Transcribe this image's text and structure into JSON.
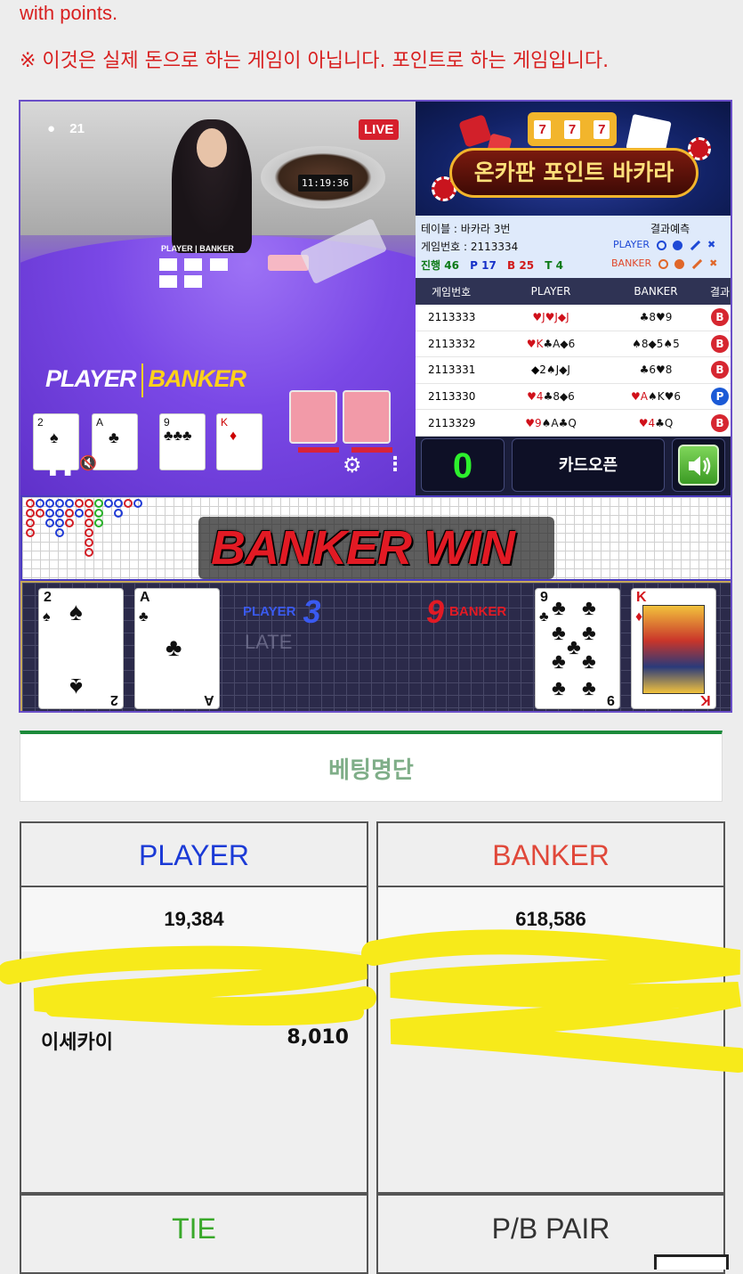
{
  "notice": {
    "line1": "with points.",
    "line2": "※ 이것은 실제 돈으로 하는 게임이 아닙니다. 포인트로 하는 게임입니다."
  },
  "video": {
    "viewers": "21",
    "live_label": "LIVE",
    "clock": "11:19:36",
    "table_label": "PLAYER | BANKER",
    "player_label": "PLAYER",
    "banker_label": "BANKER"
  },
  "logo": {
    "slot": [
      "7",
      "7",
      "7"
    ],
    "title": "온카판 포인트 바카라"
  },
  "info": {
    "table": "테이블 : 바카라 3번",
    "game_no": "게임번호 : 2113334",
    "progress_label": "진행 46",
    "p_count": "P 17",
    "b_count": "B 25",
    "t_count": "T 4",
    "prediction_title": "결과예측",
    "pred_player": "PLAYER",
    "pred_banker": "BANKER",
    "colors": {
      "player": "#1e49d6",
      "banker": "#e0672a"
    }
  },
  "history": {
    "headers": [
      "게임번호",
      "PLAYER",
      "BANKER",
      "결과"
    ],
    "rows": [
      {
        "no": "2113333",
        "player": "♥J♥J◆J",
        "banker": "♣8♥9",
        "result": "B"
      },
      {
        "no": "2113332",
        "player": "♥K♣A◆6",
        "banker": "♠8◆5♠5",
        "result": "B"
      },
      {
        "no": "2113331",
        "player": "◆2♠J◆J",
        "banker": "♣6♥8",
        "result": "B"
      },
      {
        "no": "2113330",
        "player": "♥4♣8◆6",
        "banker": "♥A♠K♥6",
        "result": "P"
      },
      {
        "no": "2113329",
        "player": "♥9♠A♣Q",
        "banker": "♥4♣Q",
        "result": "B"
      }
    ]
  },
  "controls": {
    "score": "0",
    "card_open": "카드오픈",
    "sound_icon": "speaker-icon"
  },
  "winner_text": "BANKER WIN",
  "result": {
    "player_label": "PLAYER",
    "player_score": "3",
    "banker_label": "BANKER",
    "banker_score": "9",
    "faded_text": "LATE",
    "player_cards": [
      {
        "rank": "2",
        "suit": "♠"
      },
      {
        "rank": "A",
        "suit": "♣"
      }
    ],
    "banker_cards": [
      {
        "rank": "9",
        "suit": "♣"
      },
      {
        "rank": "K",
        "suit": "♦"
      }
    ]
  },
  "betting": {
    "title": "베팅명단",
    "player_header": "PLAYER",
    "banker_header": "BANKER",
    "player_total": "19,384",
    "banker_total": "618,586",
    "player_entries": [
      {
        "name": "이세카이",
        "amount": "8,010"
      }
    ],
    "tie_header": "TIE",
    "pair_header": "P/B PAIR",
    "colors": {
      "player": "#1b3ad6",
      "banker": "#e0483a",
      "tie": "#39a82a"
    }
  }
}
